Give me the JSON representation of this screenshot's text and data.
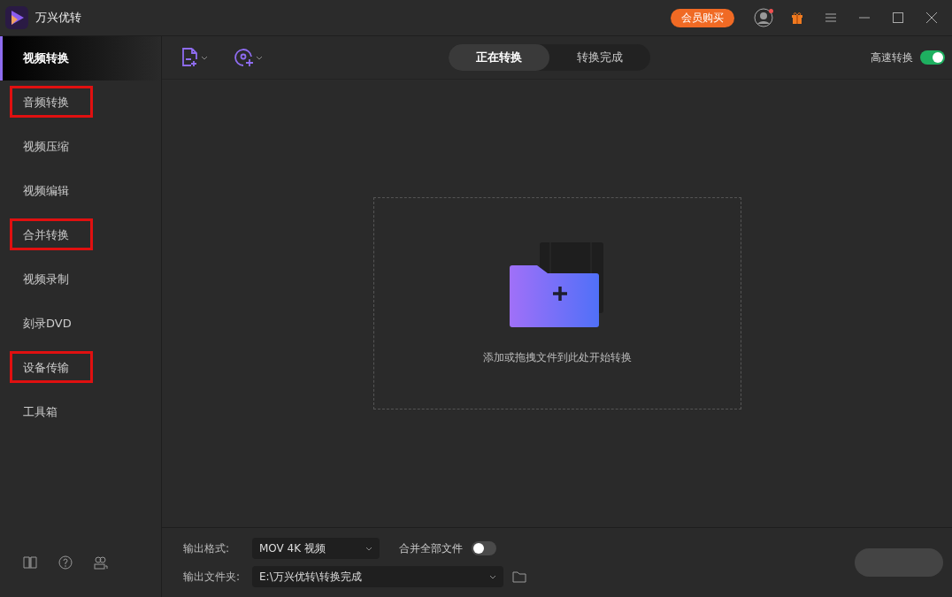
{
  "window": {
    "title": "万兴优转",
    "buy_button": "会员购买",
    "avatar_badge": true
  },
  "sidebar": {
    "items": [
      {
        "label": "视频转换",
        "selected": true,
        "highlighted": false
      },
      {
        "label": "音频转换",
        "selected": false,
        "highlighted": true
      },
      {
        "label": "视频压缩",
        "selected": false,
        "highlighted": false
      },
      {
        "label": "视频编辑",
        "selected": false,
        "highlighted": false
      },
      {
        "label": "合并转换",
        "selected": false,
        "highlighted": true
      },
      {
        "label": "视频录制",
        "selected": false,
        "highlighted": false
      },
      {
        "label": "刻录DVD",
        "selected": false,
        "highlighted": false
      },
      {
        "label": "设备传输",
        "selected": false,
        "highlighted": true
      },
      {
        "label": "工具箱",
        "selected": false,
        "highlighted": false
      }
    ]
  },
  "tabs": [
    {
      "label": "正在转换",
      "selected": true
    },
    {
      "label": "转换完成",
      "selected": false
    }
  ],
  "high_speed": {
    "label": "高速转换",
    "on": true
  },
  "drop_zone": {
    "hint": "添加或拖拽文件到此处开始转换"
  },
  "output": {
    "format_label": "输出格式:",
    "format_value": "MOV 4K 视频",
    "merge_label": "合并全部文件",
    "merge_on": false,
    "folder_label": "输出文件夹:",
    "folder_value": "E:\\万兴优转\\转换完成"
  }
}
